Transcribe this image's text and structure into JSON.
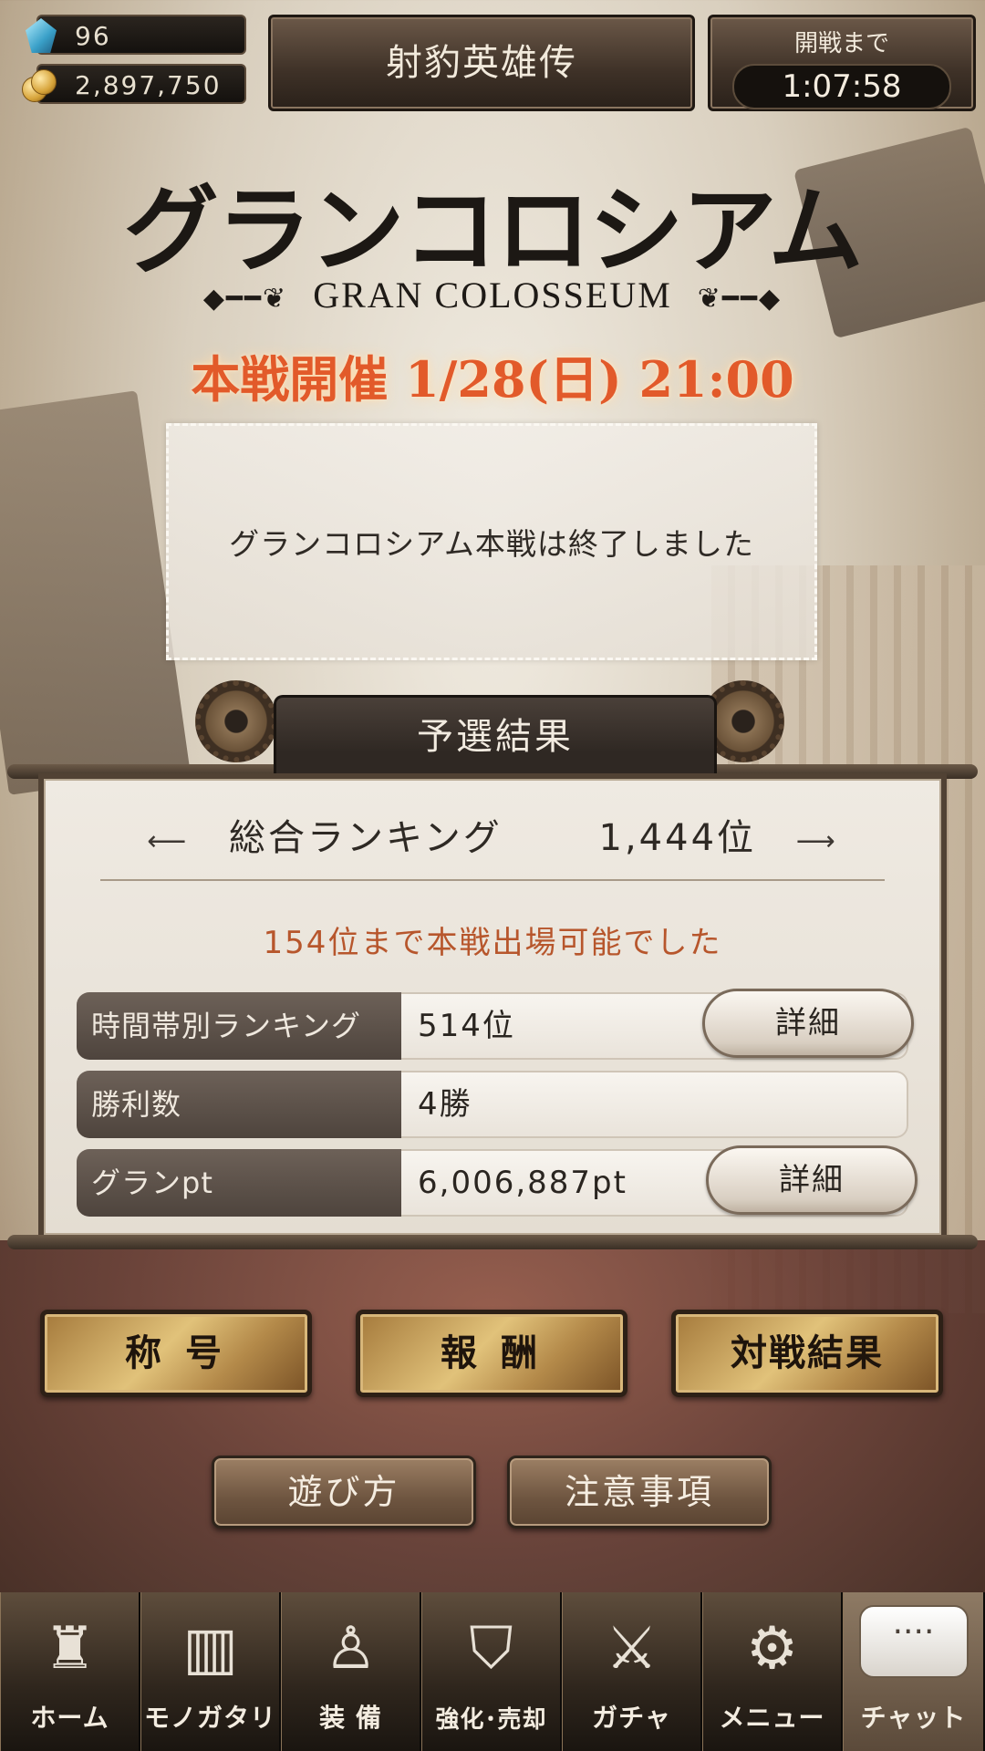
{
  "currency": {
    "gems": "96",
    "gold": "2,897,750"
  },
  "header": {
    "title": "射豹英雄传",
    "timer_label": "開戦まで",
    "timer_value": "1:07:58"
  },
  "logo": {
    "jp": "グランコロシアム",
    "en": "GRAN COLOSSEUM",
    "schedule": "本戦開催 1/28(日) 21:00"
  },
  "notice": {
    "text": "グランコロシアム本戦は終了しました"
  },
  "results": {
    "header": "予選結果",
    "overall_label": "総合ランキング",
    "overall_rank": "1,444位",
    "qualify_text": "154位まで本戦出場可能でした",
    "rows": [
      {
        "label": "時間帯別ランキング",
        "value": "514位"
      },
      {
        "label": "勝利数",
        "value": "4勝"
      },
      {
        "label": "グランpt",
        "value": "6,006,887pt"
      }
    ],
    "detail_label": "詳細"
  },
  "buttons": {
    "title": "称 号",
    "reward": "報 酬",
    "battle_result": "対戦結果",
    "how_to_play": "遊び方",
    "notes": "注意事項"
  },
  "nav": [
    {
      "label": "ホーム",
      "icon": "home-castle-icon"
    },
    {
      "label": "モノガタリ",
      "icon": "book-icon"
    },
    {
      "label": "装 備",
      "icon": "puppet-icon"
    },
    {
      "label": "強化･売却",
      "icon": "shield-icon"
    },
    {
      "label": "ガチャ",
      "icon": "swords-icon"
    },
    {
      "label": "メニュー",
      "icon": "gear-icon"
    },
    {
      "label": "チャット",
      "icon": "chat-bubble-icon"
    }
  ],
  "colors": {
    "schedule_orange": "#e25a2a",
    "qualify_orange": "#b7562c",
    "gold_button": "#e1c27a",
    "panel_brown": "#514234"
  }
}
